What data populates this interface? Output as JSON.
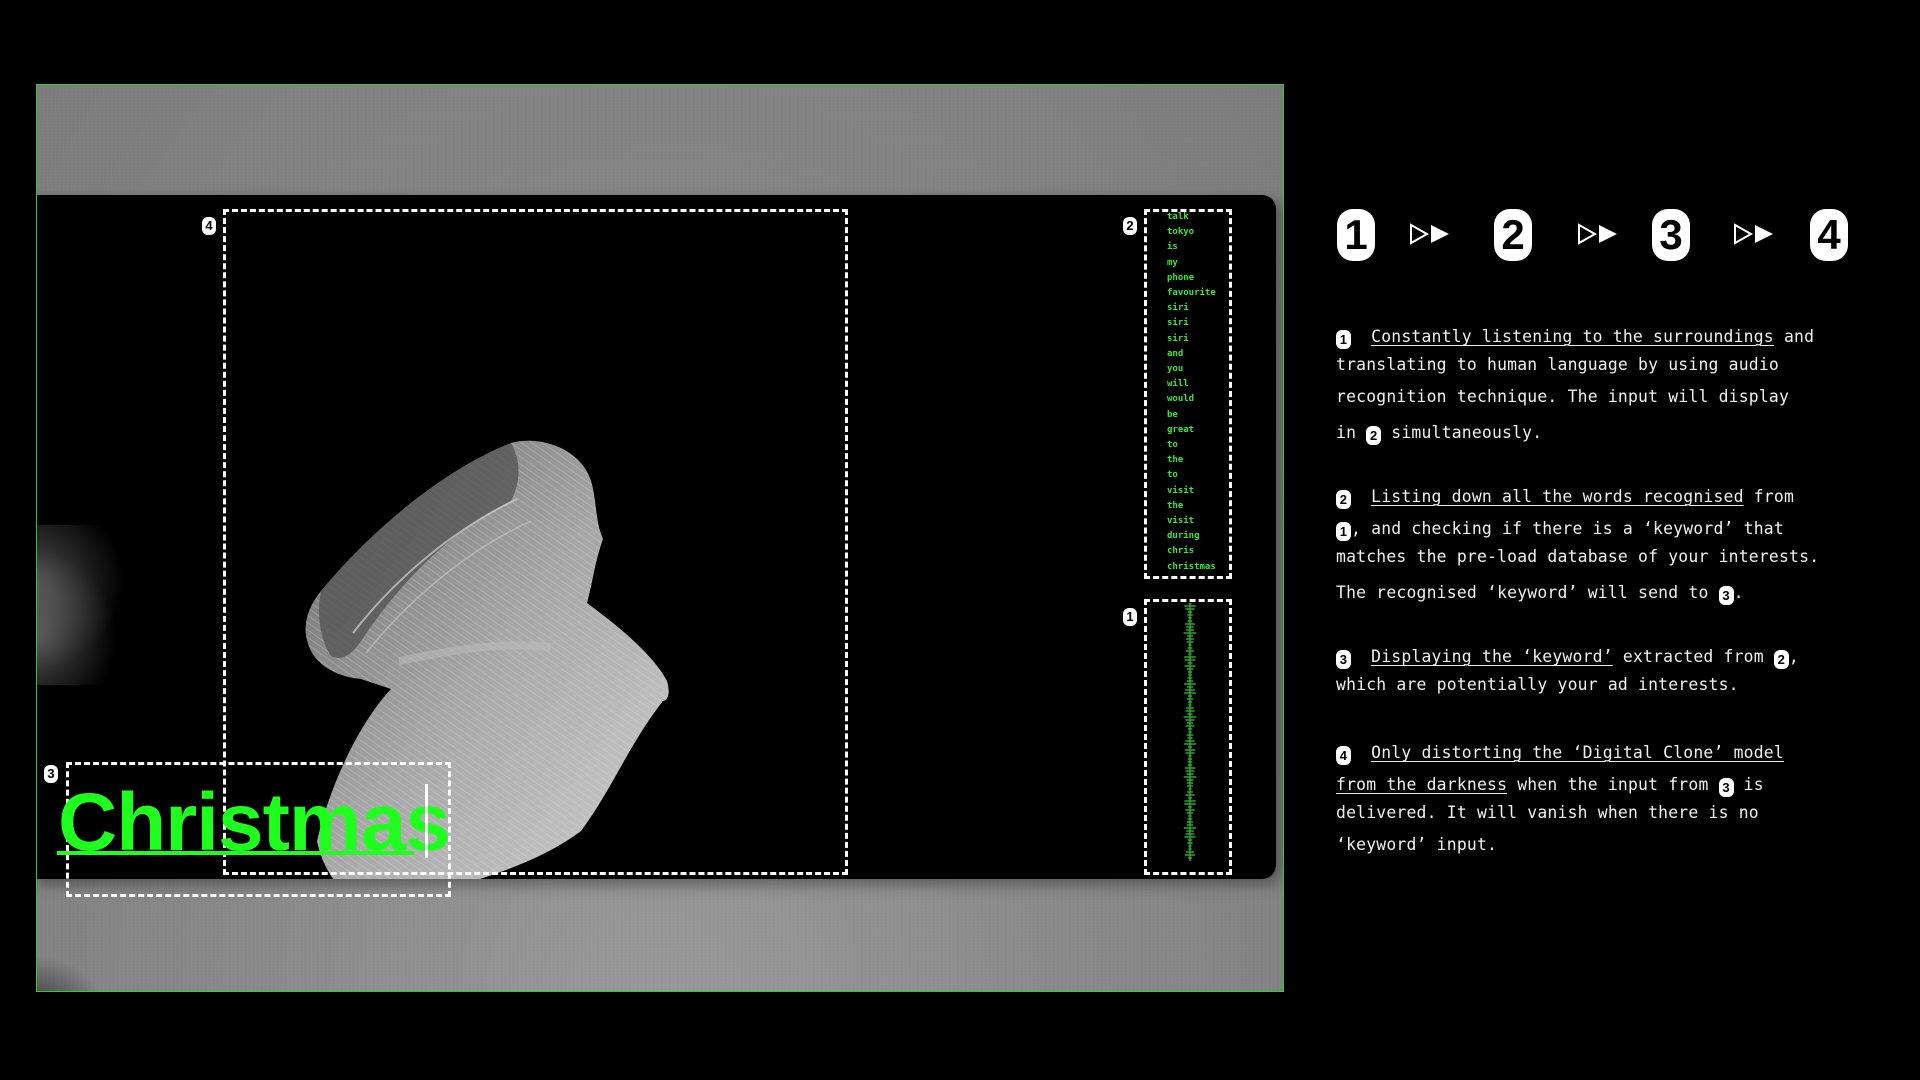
{
  "display": {
    "box_labels": {
      "audio": "1",
      "words": "2",
      "keyword": "3",
      "model": "4"
    },
    "recognised_words": [
      "talk",
      "tokyo",
      "is",
      "my",
      "phone",
      "favourite",
      "siri",
      "siri",
      "siri",
      "and",
      "you",
      "will",
      "would",
      "be",
      "great",
      "to",
      "the",
      "to",
      "visit",
      "the",
      "visit",
      "during",
      "chris",
      "christmas"
    ],
    "keyword": "Christmas",
    "accent_color": "#1eff1e",
    "frame_color": "#2ecc2e"
  },
  "flow": {
    "steps": [
      "1",
      "2",
      "3",
      "4"
    ],
    "arrow_icon": "fast-forward-icon"
  },
  "descriptions": [
    {
      "badge": "1",
      "lines": [
        {
          "u": "Constantly listening to the surroundings",
          "t": " and"
        },
        {
          "t": "translating to human language by using audio"
        },
        {
          "t": "recognition technique. The input will display"
        },
        {
          "pre": "in ",
          "ref": "2",
          "t": " simultaneously."
        }
      ]
    },
    {
      "badge": "2",
      "lines": [
        {
          "u": "Listing down all the words recognised",
          "t": " from"
        },
        {
          "ref": "1",
          "t": ", and checking if there is a ‘keyword’ that"
        },
        {
          "t": "matches the pre-load database of your interests."
        },
        {
          "pre": "The recognised ‘keyword’ will send to ",
          "ref": "3",
          "t": "."
        }
      ]
    },
    {
      "badge": "3",
      "lines": [
        {
          "u": "Displaying the ‘keyword’",
          "t": " extracted from ",
          "ref": "2",
          "post": ","
        },
        {
          "t": "which are potentially your ad interests."
        }
      ]
    },
    {
      "badge": "4",
      "lines": [
        {
          "u": "Only distorting the ‘Digital Clone’ model "
        },
        {
          "u2": "from the darkness",
          "t": " when the input from ",
          "ref": "3",
          "post": " is"
        },
        {
          "t": "delivered. It will vanish when there is no"
        },
        {
          "t": "‘keyword’ input."
        }
      ]
    }
  ]
}
